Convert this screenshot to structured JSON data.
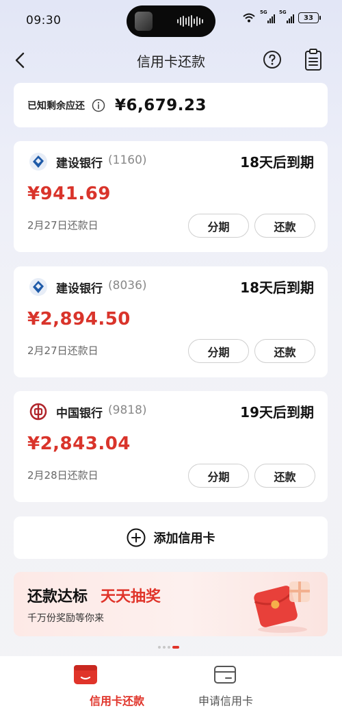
{
  "status_bar": {
    "time": "09:30",
    "signal_1_tag": "5G",
    "signal_2_tag": "5G",
    "battery": "33"
  },
  "header": {
    "title": "信用卡还款",
    "back_icon": "chevron-left-icon",
    "help_icon": "question-circle-icon",
    "record_icon": "clipboard-icon"
  },
  "summary": {
    "label": "已知剩余应还",
    "amount": "¥6,679.23"
  },
  "cards": [
    {
      "bank": "建设银行",
      "tail": "(1160)",
      "due": "18天后到期",
      "amount": "¥941.69",
      "date": "2月27日还款日",
      "installment_label": "分期",
      "repay_label": "还款",
      "logo": "ccb-logo-icon"
    },
    {
      "bank": "建设银行",
      "tail": "(8036)",
      "due": "18天后到期",
      "amount": "¥2,894.50",
      "date": "2月27日还款日",
      "installment_label": "分期",
      "repay_label": "还款",
      "logo": "ccb-logo-icon"
    },
    {
      "bank": "中国银行",
      "tail": "(9818)",
      "due": "19天后到期",
      "amount": "¥2,843.04",
      "date": "2月28日还款日",
      "installment_label": "分期",
      "repay_label": "还款",
      "logo": "boc-logo-icon"
    }
  ],
  "add_card": {
    "label": "添加信用卡"
  },
  "promo": {
    "title": "还款达标",
    "highlight": "天天抽奖",
    "subtitle": "千万份奖励等你来"
  },
  "tabs": [
    {
      "label": "信用卡还款",
      "active": true
    },
    {
      "label": "申请信用卡",
      "active": false
    }
  ],
  "colors": {
    "accent": "#e0342a",
    "amount": "#d9342b",
    "ccb_blue": "#1e5aa8",
    "boc_red": "#b0252b"
  }
}
